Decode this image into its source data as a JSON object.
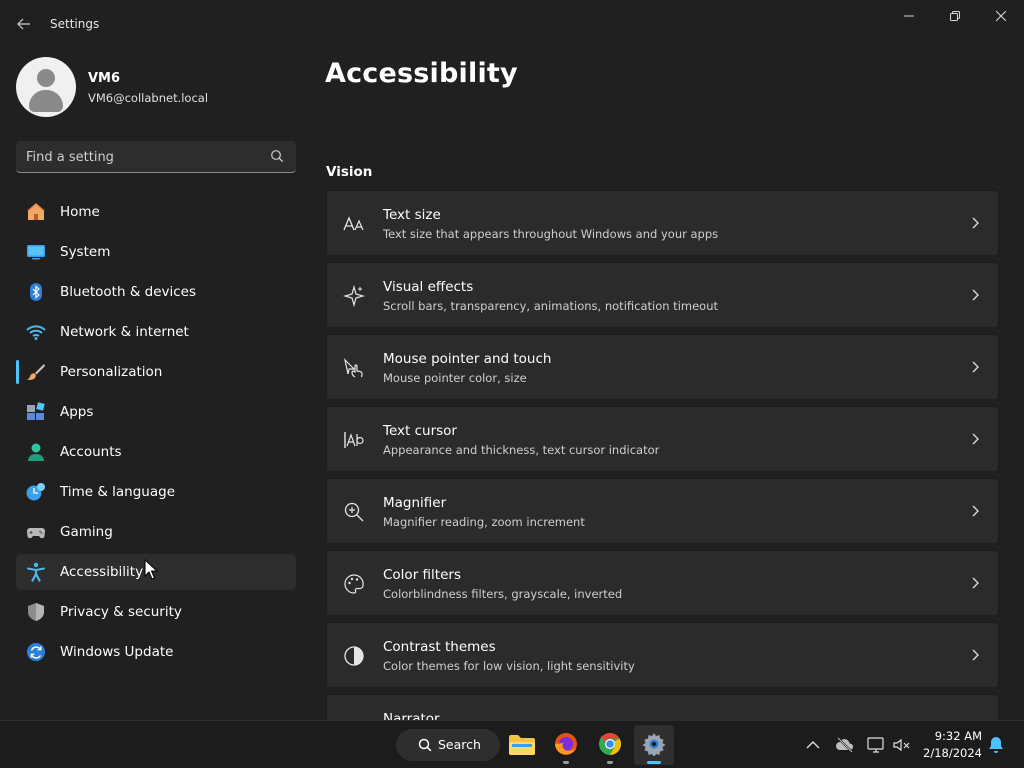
{
  "titlebar": {
    "app_title": "Settings"
  },
  "profile": {
    "name": "VM6",
    "email": "VM6@collabnet.local"
  },
  "search": {
    "placeholder": "Find a setting"
  },
  "nav": {
    "items": [
      {
        "label": "Home",
        "icon": "home-icon"
      },
      {
        "label": "System",
        "icon": "system-icon"
      },
      {
        "label": "Bluetooth & devices",
        "icon": "bluetooth-icon"
      },
      {
        "label": "Network & internet",
        "icon": "wifi-icon"
      },
      {
        "label": "Personalization",
        "icon": "brush-icon"
      },
      {
        "label": "Apps",
        "icon": "apps-icon"
      },
      {
        "label": "Accounts",
        "icon": "accounts-icon"
      },
      {
        "label": "Time & language",
        "icon": "clock-globe-icon"
      },
      {
        "label": "Gaming",
        "icon": "gamepad-icon"
      },
      {
        "label": "Accessibility",
        "icon": "accessibility-icon"
      },
      {
        "label": "Privacy & security",
        "icon": "shield-icon"
      },
      {
        "label": "Windows Update",
        "icon": "update-icon"
      }
    ],
    "selected": "Accessibility"
  },
  "main": {
    "page_title": "Accessibility",
    "section_title": "Vision",
    "cards": [
      {
        "title": "Text size",
        "subtitle": "Text size that appears throughout Windows and your apps",
        "icon": "text-size-icon"
      },
      {
        "title": "Visual effects",
        "subtitle": "Scroll bars, transparency, animations, notification timeout",
        "icon": "sparkle-icon"
      },
      {
        "title": "Mouse pointer and touch",
        "subtitle": "Mouse pointer color, size",
        "icon": "pointer-touch-icon"
      },
      {
        "title": "Text cursor",
        "subtitle": "Appearance and thickness, text cursor indicator",
        "icon": "text-cursor-icon"
      },
      {
        "title": "Magnifier",
        "subtitle": "Magnifier reading, zoom increment",
        "icon": "magnifier-icon"
      },
      {
        "title": "Color filters",
        "subtitle": "Colorblindness filters, grayscale, inverted",
        "icon": "palette-icon"
      },
      {
        "title": "Contrast themes",
        "subtitle": "Color themes for low vision, light sensitivity",
        "icon": "contrast-icon"
      },
      {
        "title": "Narrator",
        "subtitle": "",
        "icon": "narrator-icon"
      }
    ]
  },
  "taskbar": {
    "search_label": "Search",
    "time": "9:32 AM",
    "date": "2/18/2024"
  },
  "colors": {
    "accent": "#4cc2ff",
    "background": "#202020",
    "card": "#2b2b2b"
  }
}
